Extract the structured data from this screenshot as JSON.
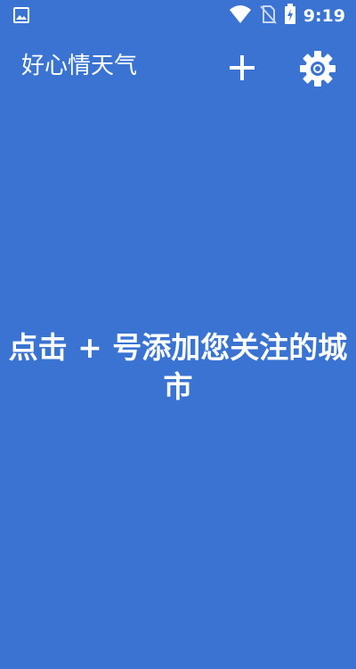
{
  "status_bar": {
    "time": "9:19",
    "icons": [
      "image-icon",
      "wifi-icon",
      "no-sim-icon",
      "battery-charging-icon"
    ]
  },
  "app_bar": {
    "title": "好心情天气",
    "add_icon": "plus-icon",
    "settings_icon": "gear-icon"
  },
  "main": {
    "empty_message": "点击 + 号添加您关注的城市"
  },
  "colors": {
    "background": "#3a73d2",
    "foreground": "#ffffff"
  }
}
